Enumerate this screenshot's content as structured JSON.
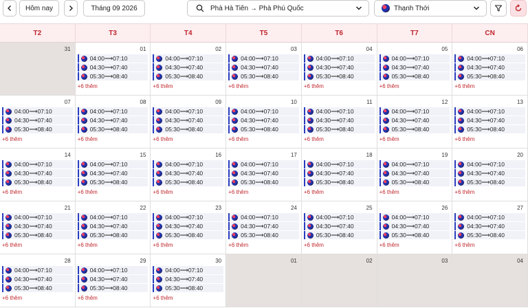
{
  "toolbar": {
    "today_label": "Hôm nay",
    "month_label": "Tháng 09 2026",
    "route_label": "Phà Hà Tiên → Phà Phú Quốc",
    "vessel_label": "Thạnh Thới"
  },
  "weekdays": [
    "T2",
    "T3",
    "T4",
    "T5",
    "T6",
    "T7",
    "CN"
  ],
  "trip_times": [
    "04:00⟶07:10",
    "04:30⟶07:40",
    "05:30⟶08:40"
  ],
  "more_label": "+6 thêm",
  "days": [
    {
      "num": "31",
      "in_month": false
    },
    {
      "num": "01",
      "in_month": true
    },
    {
      "num": "02",
      "in_month": true
    },
    {
      "num": "03",
      "in_month": true
    },
    {
      "num": "04",
      "in_month": true
    },
    {
      "num": "05",
      "in_month": true
    },
    {
      "num": "06",
      "in_month": true
    },
    {
      "num": "07",
      "in_month": true
    },
    {
      "num": "08",
      "in_month": true
    },
    {
      "num": "09",
      "in_month": true
    },
    {
      "num": "10",
      "in_month": true
    },
    {
      "num": "11",
      "in_month": true
    },
    {
      "num": "12",
      "in_month": true
    },
    {
      "num": "13",
      "in_month": true
    },
    {
      "num": "14",
      "in_month": true
    },
    {
      "num": "15",
      "in_month": true
    },
    {
      "num": "16",
      "in_month": true
    },
    {
      "num": "17",
      "in_month": true
    },
    {
      "num": "18",
      "in_month": true
    },
    {
      "num": "19",
      "in_month": true
    },
    {
      "num": "20",
      "in_month": true
    },
    {
      "num": "21",
      "in_month": true
    },
    {
      "num": "22",
      "in_month": true
    },
    {
      "num": "23",
      "in_month": true
    },
    {
      "num": "24",
      "in_month": true
    },
    {
      "num": "25",
      "in_month": true
    },
    {
      "num": "26",
      "in_month": true
    },
    {
      "num": "27",
      "in_month": true
    },
    {
      "num": "28",
      "in_month": true
    },
    {
      "num": "29",
      "in_month": true
    },
    {
      "num": "30",
      "in_month": true
    },
    {
      "num": "01",
      "in_month": false
    },
    {
      "num": "02",
      "in_month": false
    },
    {
      "num": "03",
      "in_month": false
    },
    {
      "num": "04",
      "in_month": false
    }
  ],
  "colors": {
    "accent": "#c0262d",
    "trip_bar": "#2a3dbf",
    "header_bg": "#fdeef0",
    "other_month_bg": "#e6e1de"
  },
  "icons": {
    "prev": "chevron-left-icon",
    "next": "chevron-right-icon",
    "search": "search-icon",
    "dropdown": "chevron-down-icon",
    "filter": "filter-icon",
    "refresh": "refresh-icon"
  }
}
